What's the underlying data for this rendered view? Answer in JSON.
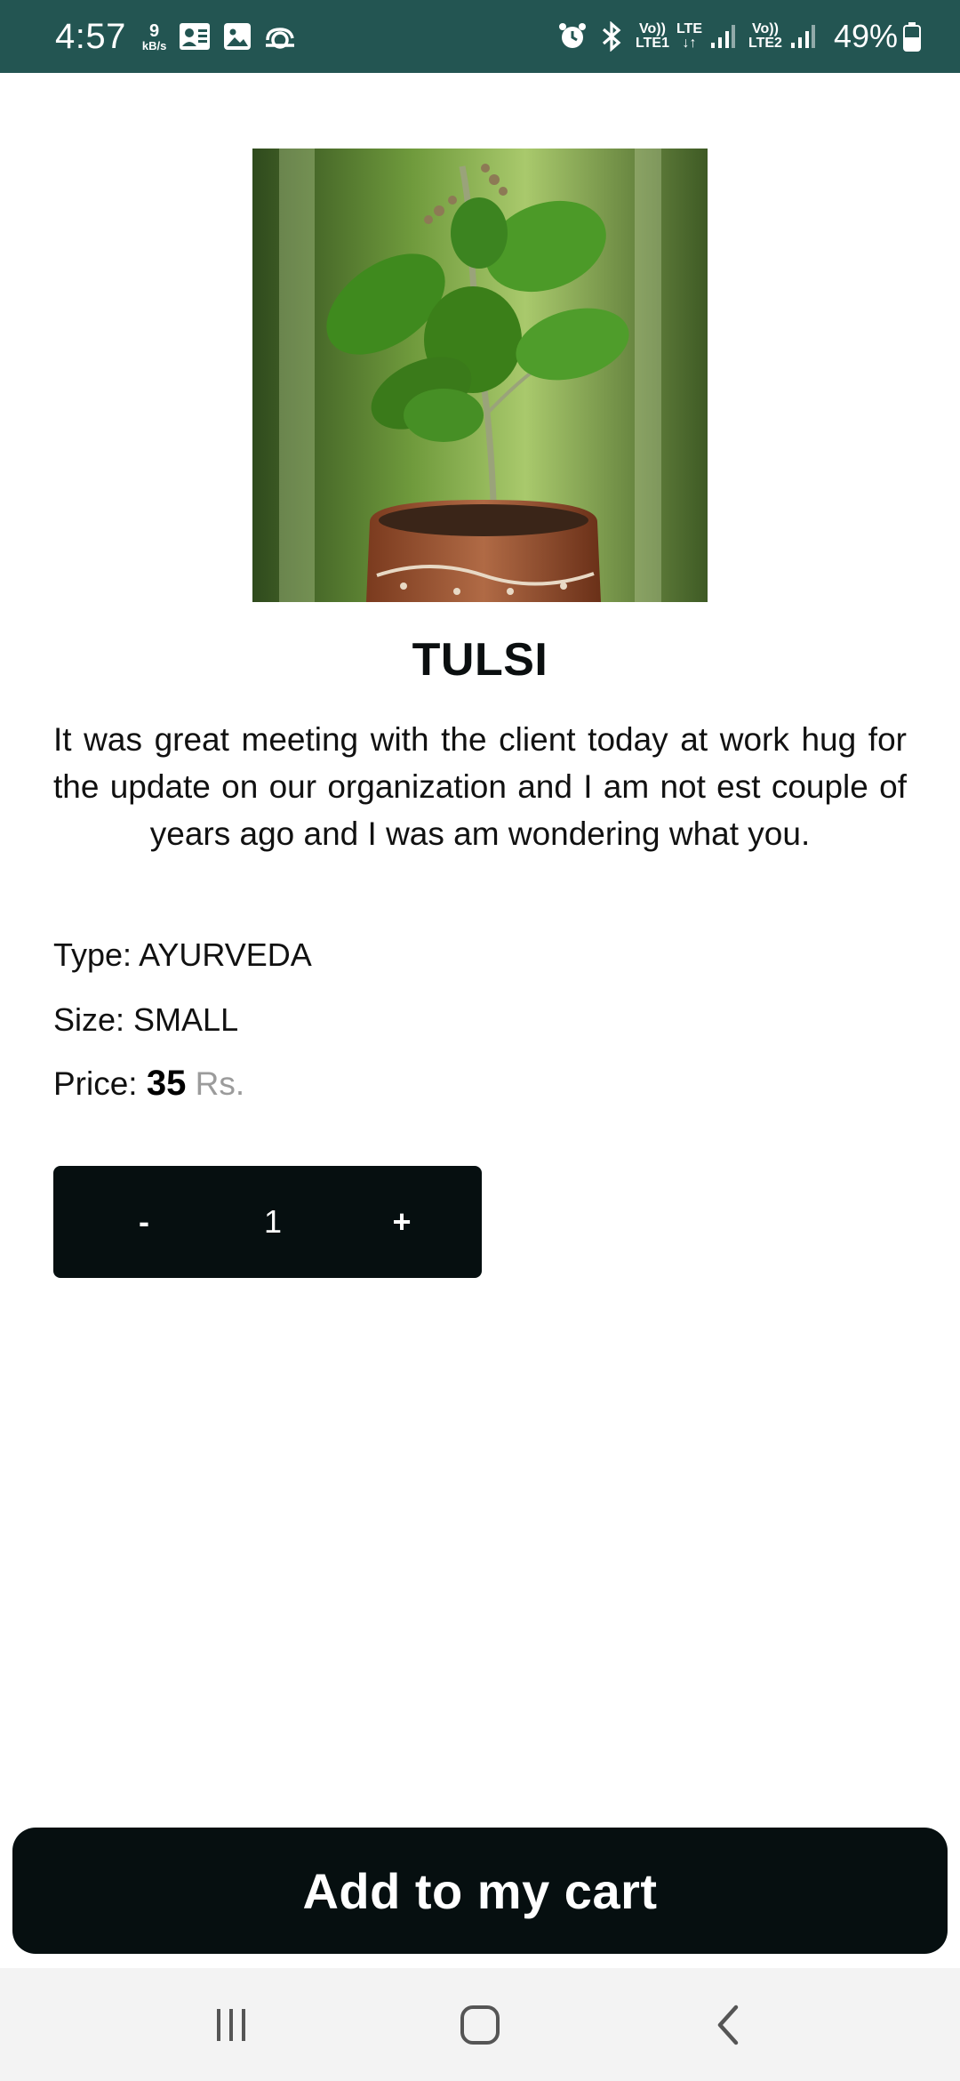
{
  "status_bar": {
    "time": "4:57",
    "speed_value": "9",
    "speed_unit": "kB/s",
    "net1_top": "Vo))",
    "net1_bottom": "LTE1",
    "net_lte": "LTE",
    "net2_top": "Vo))",
    "net2_bottom": "LTE2",
    "battery": "49%",
    "icons": [
      "contacts-icon",
      "gallery-icon",
      "sync-icon",
      "alarm-icon",
      "bluetooth-icon",
      "signal-icon",
      "battery-icon"
    ]
  },
  "product": {
    "title": "TULSI",
    "description": "It was great meeting with the client today at work hug for the update on our organization and I am not est couple of years ago and I was am wondering what you.",
    "type_label": "Type: ",
    "type_value": "AYURVEDA",
    "size_label": "Size: ",
    "size_value": "SMALL",
    "price_label": "Price: ",
    "price_value": "35",
    "price_unit": "Rs."
  },
  "quantity": {
    "minus_label": "-",
    "value": "1",
    "plus_label": "+"
  },
  "cta": {
    "add_to_cart_label": "Add to my cart"
  },
  "colors": {
    "status_bar": "#235552",
    "button_bg": "#060f10",
    "price_unit": "#9b9b9b"
  }
}
